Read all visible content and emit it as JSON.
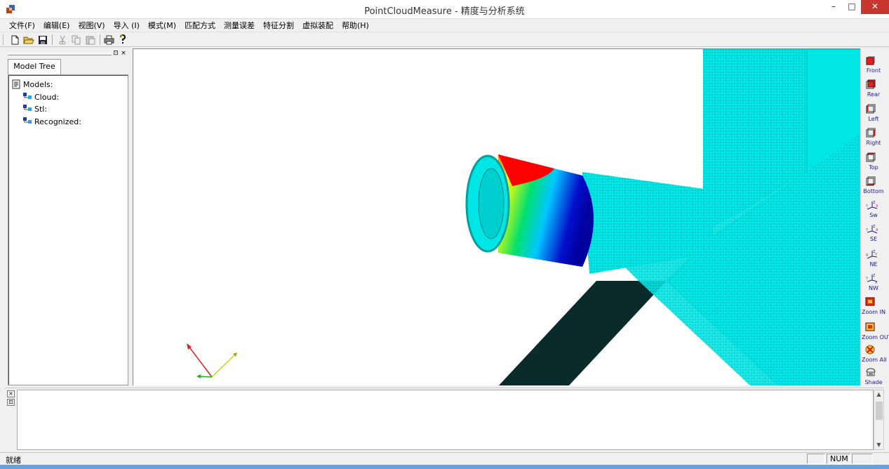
{
  "window": {
    "title": "PointCloudMeasure - 精度与分析系统",
    "controls": {
      "minimize": "–",
      "maximize": "□",
      "close": "✕"
    }
  },
  "menu": {
    "items": [
      "文件(F)",
      "编辑(E)",
      "视图(V)",
      "导入 (I)",
      "模式(M)",
      "匹配方式",
      "测量误差",
      "特征分割",
      "虚拟装配",
      "帮助(H)"
    ]
  },
  "toolbar": {
    "buttons": [
      "new-file-icon",
      "open-folder-icon",
      "save-icon",
      "cut-icon",
      "copy-icon",
      "paste-icon",
      "print-icon",
      "help-icon"
    ]
  },
  "left_pane": {
    "tab_label": "Model Tree",
    "pin_glyph": "⊡",
    "close_glyph": "×",
    "tree": {
      "root": "Models:",
      "children": [
        "Cloud:",
        "Stl:",
        "Recognized:"
      ]
    }
  },
  "view_toolbar": {
    "buttons": [
      {
        "label": "Front",
        "icon": "front-view-icon"
      },
      {
        "label": "Rear",
        "icon": "rear-view-icon"
      },
      {
        "label": "Left",
        "icon": "left-view-icon"
      },
      {
        "label": "Right",
        "icon": "right-view-icon"
      },
      {
        "label": "Top",
        "icon": "top-view-icon"
      },
      {
        "label": "Bottom",
        "icon": "bottom-view-icon"
      },
      {
        "label": "Sw",
        "icon": "sw-iso-view-icon"
      },
      {
        "label": "SE",
        "icon": "se-iso-view-icon"
      },
      {
        "label": "NE",
        "icon": "ne-iso-view-icon"
      },
      {
        "label": "NW",
        "icon": "nw-iso-view-icon"
      },
      {
        "label": "Zoom IN",
        "icon": "zoom-in-icon"
      },
      {
        "label": "Zoom OUT",
        "icon": "zoom-out-icon"
      },
      {
        "label": "Zoom All",
        "icon": "zoom-all-icon"
      },
      {
        "label": "Shade",
        "icon": "shade-icon"
      }
    ]
  },
  "output_pane": {
    "close_glyph": "×",
    "pin_glyph": "⊡",
    "text": ""
  },
  "status_bar": {
    "message": "就绪",
    "indicators": [
      "",
      "NUM",
      ""
    ]
  },
  "colors": {
    "cloud": "#00e5e5",
    "error_map": [
      "#0000cc",
      "#00c8ff",
      "#00e070",
      "#ffff00",
      "#ff8800",
      "#ff0000"
    ],
    "view_label": "#1a1a9a"
  }
}
